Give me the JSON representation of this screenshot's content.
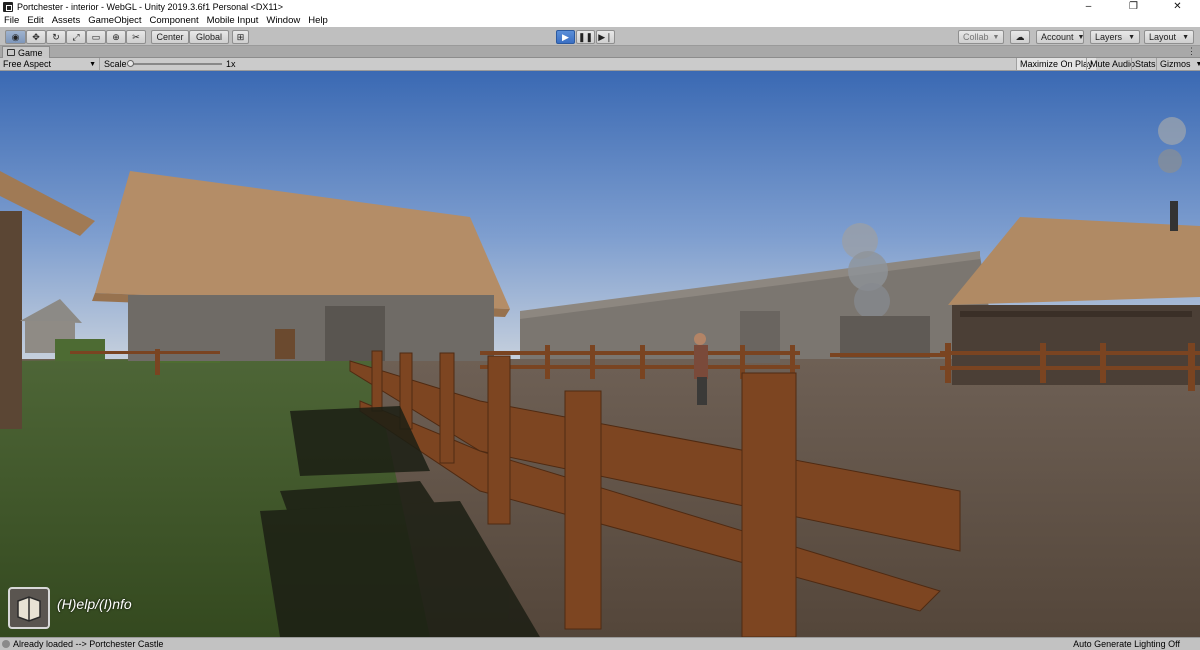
{
  "window": {
    "title": "Portchester - interior - WebGL - Unity 2019.3.6f1 Personal <DX11>",
    "controls": [
      "–",
      "❐",
      "✕"
    ]
  },
  "menu": [
    "File",
    "Edit",
    "Assets",
    "GameObject",
    "Component",
    "Mobile Input",
    "Window",
    "Help"
  ],
  "toolbar": {
    "pivot_label": "Center",
    "space_label": "Global",
    "collab_label": "Collab",
    "account_label": "Account",
    "layers_label": "Layers",
    "layout_label": "Layout",
    "play_state": "playing"
  },
  "game_tab": {
    "label": "Game"
  },
  "game_controls": {
    "aspect": "Free Aspect",
    "scale_label": "Scale",
    "scale_value": "1x",
    "maximize_label": "Maximize On Play",
    "mute_label": "Mute Audio",
    "stats_label": "Stats",
    "gizmos_label": "Gizmos"
  },
  "hud": {
    "help_text": "(H)elp/(I)nfo"
  },
  "status": {
    "message": "Already loaded --> Portchester Castle",
    "lighting": "Auto Generate Lighting Off"
  },
  "colors": {
    "sky_top": "#3b6bb5",
    "sky_bottom": "#c9d3df",
    "grass": "#3f5a2c",
    "dirt": "#5e4d3e",
    "fence": "#7a4421",
    "roof": "#b48d67",
    "play_accent": "#3a6fc4"
  }
}
